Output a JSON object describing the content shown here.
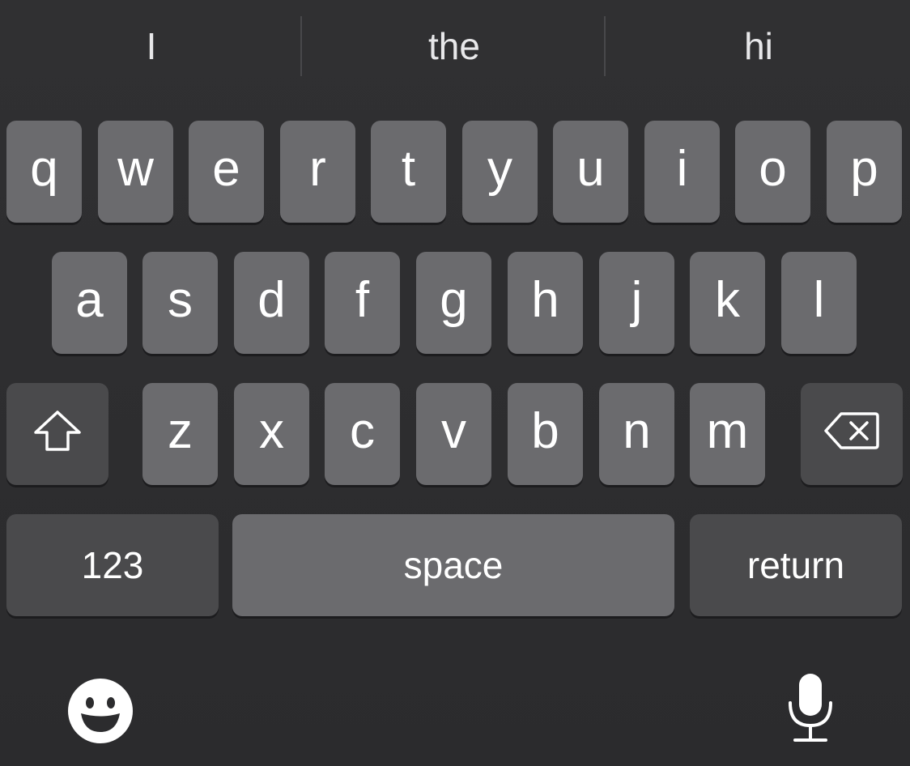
{
  "suggestions": [
    "I",
    "the",
    "hi"
  ],
  "rows": {
    "row1": [
      "q",
      "w",
      "e",
      "r",
      "t",
      "y",
      "u",
      "i",
      "o",
      "p"
    ],
    "row2": [
      "a",
      "s",
      "d",
      "f",
      "g",
      "h",
      "j",
      "k",
      "l"
    ],
    "row3": [
      "z",
      "x",
      "c",
      "v",
      "b",
      "n",
      "m"
    ]
  },
  "bottom_row": {
    "numbers_label": "123",
    "space_label": "space",
    "return_label": "return"
  },
  "icons": {
    "shift": "shift-arrow-icon",
    "delete": "backspace-icon",
    "emoji": "emoji-smiley-icon",
    "dictation": "microphone-icon"
  },
  "colors": {
    "background": "#2c2c2e",
    "letter_key": "#6b6b6e",
    "function_key": "#4a4a4c",
    "text": "#ffffff"
  }
}
